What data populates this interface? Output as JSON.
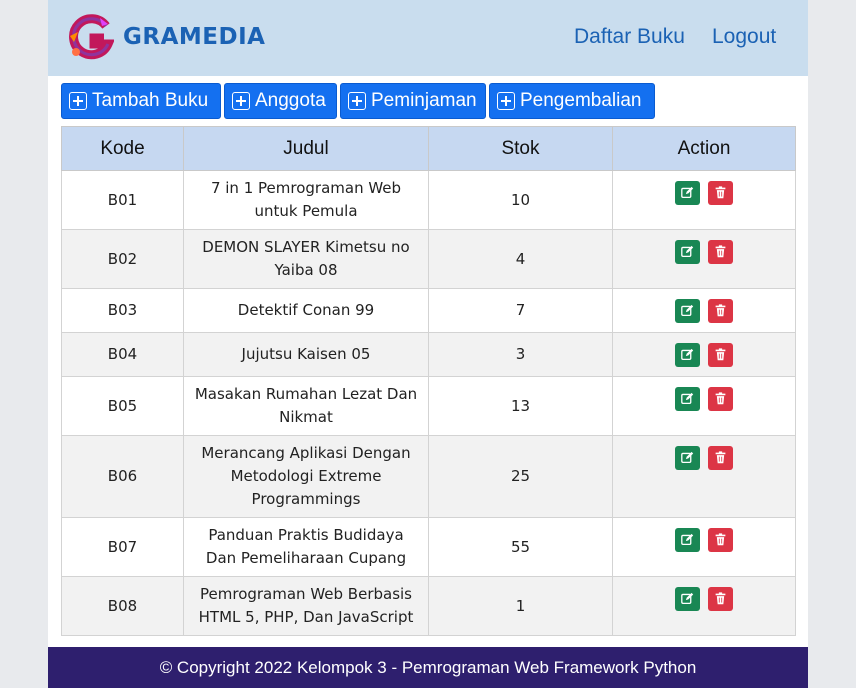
{
  "header": {
    "brand": "GRAMEDIA",
    "nav": {
      "daftar_buku": "Daftar Buku",
      "logout": "Logout"
    }
  },
  "toolbar": {
    "tambah_buku": "Tambah Buku",
    "anggota": "Anggota",
    "peminjaman": "Peminjaman",
    "pengembalian": "Pengembalian"
  },
  "table": {
    "columns": [
      "Kode",
      "Judul",
      "Stok",
      "Action"
    ],
    "rows": [
      {
        "kode": "B01",
        "judul": "7 in 1 Pemrograman Web untuk Pemula",
        "stok": "10"
      },
      {
        "kode": "B02",
        "judul": "DEMON SLAYER Kimetsu no Yaiba 08",
        "stok": "4"
      },
      {
        "kode": "B03",
        "judul": "Detektif Conan 99",
        "stok": "7"
      },
      {
        "kode": "B04",
        "judul": "Jujutsu Kaisen 05",
        "stok": "3"
      },
      {
        "kode": "B05",
        "judul": "Masakan Rumahan Lezat Dan Nikmat",
        "stok": "13"
      },
      {
        "kode": "B06",
        "judul": "Merancang Aplikasi Dengan Metodologi Extreme Programmings",
        "stok": "25"
      },
      {
        "kode": "B07",
        "judul": "Panduan Praktis Budidaya Dan Pemeliharaan Cupang",
        "stok": "55"
      },
      {
        "kode": "B08",
        "judul": "Pemrograman Web Berbasis HTML 5, PHP, Dan JavaScript",
        "stok": "1"
      }
    ]
  },
  "footer": {
    "text": "© Copyright 2022 Kelompok 3 - Pemrograman Web Framework Python"
  },
  "colors": {
    "header_bg": "#c9ddee",
    "brand": "#1b62b4",
    "primary": "#1470f0",
    "success": "#198754",
    "danger": "#dc3545",
    "footer_bg": "#2e1f6e"
  },
  "icons": {
    "logo": "gramedia-logo-icon",
    "add": "plus-square-icon",
    "edit": "pencil-square-icon",
    "delete": "trash-icon"
  }
}
